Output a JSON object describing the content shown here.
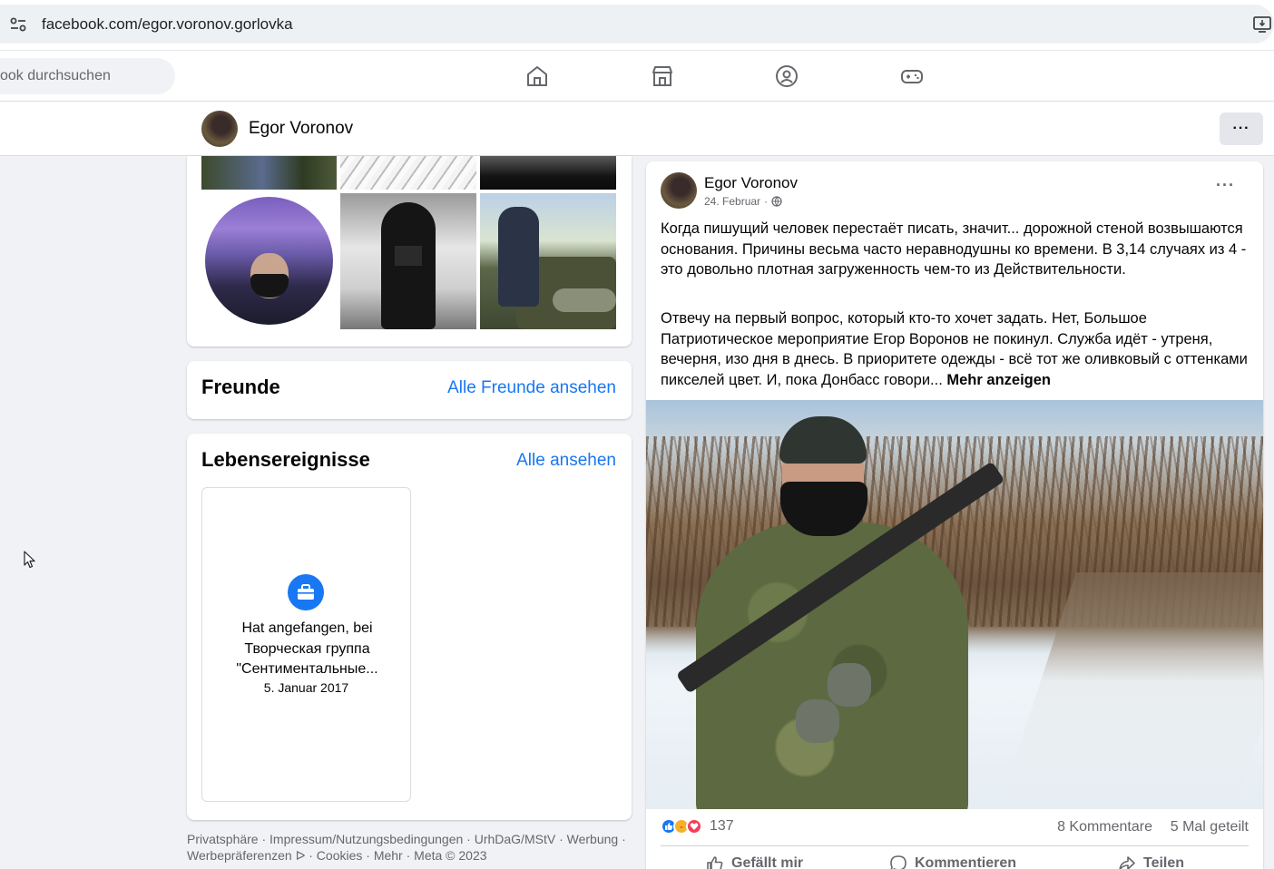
{
  "browser": {
    "url": "facebook.com/egor.voronov.gorlovka",
    "site_info_icon": "tune-icon",
    "install_icon": "install-app-icon"
  },
  "fb_nav": {
    "search_placeholder": "ook durchsuchen",
    "icons": [
      "home-icon",
      "marketplace-icon",
      "groups-icon",
      "gaming-icon"
    ]
  },
  "profile": {
    "name": "Egor Voronov",
    "more_label": "···"
  },
  "friends": {
    "title": "Freunde",
    "link": "Alle Freunde ansehen"
  },
  "life_events": {
    "title": "Lebensereignisse",
    "link": "Alle ansehen",
    "event_title": "Hat angefangen, bei Творческая группа \"Сентиментальные...",
    "event_date": "5. Januar 2017"
  },
  "footer": {
    "text": "Privatsphäre · Impressum/Nutzungsbedingungen · UrhDaG/MStV · Werbung · Werbepräferenzen ᐅ · Cookies · Mehr · Meta © 2023"
  },
  "post": {
    "author": "Egor Voronov",
    "date": "24. Februar",
    "date_separator": "·",
    "more_label": "···",
    "paragraph_1": "Когда пишущий человек перестаёт писать, значит... дорожной стеной возвышаются основания. Причины весьма часто неравнодушны ко времени. В 3,14 случаях из 4 - это довольно плотная загруженность чем-то из Действительности.",
    "paragraph_2": "Отвечу на первый вопрос, который кто-то хочет задать. Нет, Большое Патриотическое мероприятие Егор Воронов не покинул. Служба идёт - утреня, вечерня, изо дня в днесь. В приоритете одежды - всё тот же оливковый с оттенками пикселей цвет. И, пока Донбасс говори...",
    "see_more": "Mehr anzeigen",
    "reaction_count": "137",
    "comments": "8 Kommentare",
    "shares": "5 Mal geteilt",
    "actions": {
      "like": "Gefällt mir",
      "comment": "Kommentieren",
      "share": "Teilen"
    }
  },
  "colors": {
    "accent": "#1877f2",
    "background": "#f0f2f5",
    "secondary_text": "#65676b"
  }
}
